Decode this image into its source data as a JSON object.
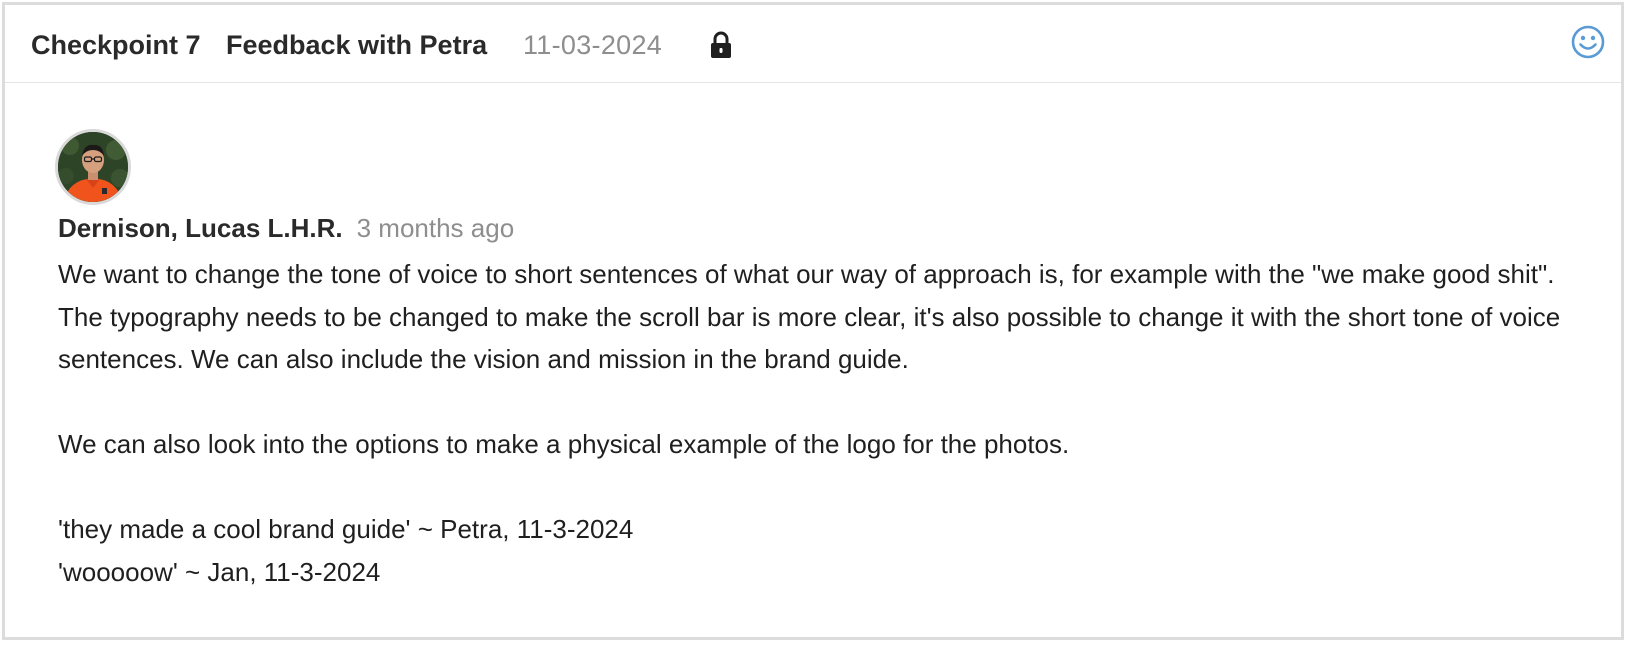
{
  "header": {
    "checkpoint": "Checkpoint 7",
    "title": "Feedback with Petra",
    "date": "11-03-2024",
    "lock_icon": "lock-icon",
    "reaction_icon": "smiley-icon",
    "reaction_color": "#5b9bd5"
  },
  "comment": {
    "avatar_icon": "user-avatar",
    "author": "Dernison, Lucas L.H.R.",
    "time_ago": "3 months ago",
    "paragraph_1": "We want to change the tone of voice to short sentences of what our way of approach is, for example with the \"we make good shit\". The typography needs to be changed to make the scroll bar is more clear, it's also possible to change it with the short tone of voice sentences. We can also include the vision and mission in the brand guide.",
    "paragraph_2": "We can also look into the options to make a physical example of the logo for the photos.",
    "quote_1": "'they made a cool brand guide' ~ Petra, 11-3-2024",
    "quote_2": "'wooooow' ~ Jan, 11-3-2024"
  }
}
